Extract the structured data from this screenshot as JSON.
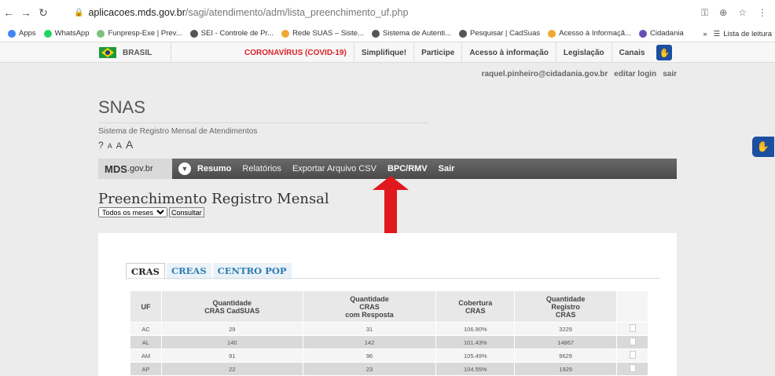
{
  "browser": {
    "url_host": "aplicacoes.mds.gov.br",
    "url_path": "/sagi/atendimento/adm/lista_preenchimento_uf.php",
    "bookmarks": [
      {
        "label": "Apps",
        "color": "#4285f4"
      },
      {
        "label": "WhatsApp",
        "color": "#25d366"
      },
      {
        "label": "Funpresp-Exe | Prev...",
        "color": "#7fbf7f"
      },
      {
        "label": "SEI - Controle de Pr...",
        "color": "#555555"
      },
      {
        "label": "Rede SUAS – Siste...",
        "color": "#f0a830"
      },
      {
        "label": "Sistema de Autenti...",
        "color": "#555555"
      },
      {
        "label": "Pesquisar | CadSuas",
        "color": "#555555"
      },
      {
        "label": "Acesso à Informaçã...",
        "color": "#f0a830"
      },
      {
        "label": "Cidadania",
        "color": "#6a4fb5"
      }
    ],
    "reading_list": "Lista de leitura"
  },
  "govbar": {
    "brasil": "BRASIL",
    "links": [
      "CORONAVÍRUS (COVID-19)",
      "Simplifique!",
      "Participe",
      "Acesso à informação",
      "Legislação",
      "Canais"
    ]
  },
  "user": {
    "email": "raquel.pinheiro@cidadania.gov.br",
    "edit": "editar login",
    "logout": "sair"
  },
  "site": {
    "title": "SNAS",
    "subtitle": "Sistema de Registro Mensal de Atendimentos",
    "a11y_help": "?",
    "a11y_small": "A",
    "a11y_medium": "A",
    "a11y_large": "A"
  },
  "menu": {
    "logo_bold": "MDS",
    "logo_gov": ".gov.br",
    "items": [
      "Resumo",
      "Relatórios",
      "Exportar Arquivo CSV",
      "BPC/RMV",
      "Sair"
    ]
  },
  "page": {
    "title": "Preenchimento Registro Mensal",
    "filter_value": "Todos os meses",
    "submit": "Consultar"
  },
  "tabs": [
    "CRAS",
    "CREAS",
    "CENTRO POP"
  ],
  "table": {
    "headers": [
      "UF",
      "Quantidade\nCRAS CadSUAS",
      "Quantidade\nCRAS\ncom Resposta",
      "Cobertura\nCRAS",
      "Quantidade\nRegistro\nCRAS",
      ""
    ],
    "rows": [
      [
        "AC",
        "29",
        "31",
        "106.90%",
        "3229"
      ],
      [
        "AL",
        "140",
        "142",
        "101.43%",
        "14867"
      ],
      [
        "AM",
        "91",
        "96",
        "105.49%",
        "9629"
      ],
      [
        "AP",
        "22",
        "23",
        "104.55%",
        "1929"
      ]
    ]
  },
  "colors": {
    "arrow": "#e0191f",
    "covid": "#d9242b",
    "tab_link": "#2e7db2"
  }
}
